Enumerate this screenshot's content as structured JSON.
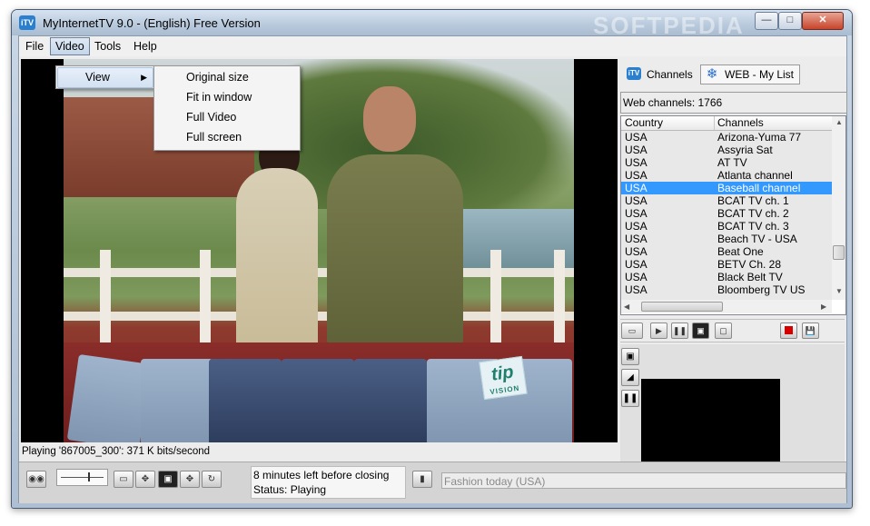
{
  "window": {
    "title": "MyInternetTV 9.0 - (English) Free Version",
    "app_icon_text": "iTV",
    "watermark": "SOFTPEDIA"
  },
  "menubar": {
    "items": [
      "File",
      "Video",
      "Tools",
      "Help"
    ]
  },
  "video_menu": {
    "items": [
      "View"
    ]
  },
  "view_submenu": {
    "items": [
      "Original size",
      "Fit in window",
      "Full Video",
      "Full screen"
    ]
  },
  "video": {
    "logo_text": "tip",
    "logo_sub": "VISION"
  },
  "playing_status": "Playing '867005_300': 371 K bits/second",
  "right_panel": {
    "tabs": [
      {
        "label": "Channels",
        "icon": "tv-icon"
      },
      {
        "label": "WEB - My List",
        "icon": "globe-icon"
      }
    ],
    "web_channels_count": "Web channels: 1766",
    "columns": [
      "Country",
      "Channels"
    ],
    "rows": [
      {
        "country": "USA",
        "channel": "Arizona-Yuma 77"
      },
      {
        "country": "USA",
        "channel": "Assyria Sat"
      },
      {
        "country": "USA",
        "channel": "AT TV"
      },
      {
        "country": "USA",
        "channel": "Atlanta channel"
      },
      {
        "country": "USA",
        "channel": "Baseball channel",
        "selected": true
      },
      {
        "country": "USA",
        "channel": "BCAT TV ch. 1"
      },
      {
        "country": "USA",
        "channel": "BCAT TV ch. 2"
      },
      {
        "country": "USA",
        "channel": "BCAT TV ch. 3"
      },
      {
        "country": "USA",
        "channel": "Beach TV - USA"
      },
      {
        "country": "USA",
        "channel": "Beat One"
      },
      {
        "country": "USA",
        "channel": "BETV Ch. 28"
      },
      {
        "country": "USA",
        "channel": "Black Belt TV"
      },
      {
        "country": "USA",
        "channel": "Bloomberg TV US"
      }
    ]
  },
  "bottom": {
    "closing_text": "8 minutes left before closing",
    "status_text": "Status: Playing",
    "now_playing": "Fashion today (USA)"
  },
  "colors": {
    "selection": "#3399ff",
    "record": "#d40000"
  }
}
